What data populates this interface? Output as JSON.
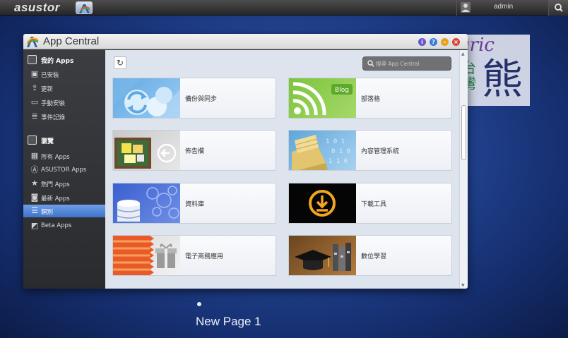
{
  "topbar": {
    "brand": "asustor",
    "username": "admin"
  },
  "watermark": {
    "gric": "gric",
    "taiwan": "台灣",
    "bear": "熊"
  },
  "window": {
    "title": "App Central",
    "buttons": [
      {
        "name": "info-icon",
        "glyph": "i",
        "color": "#6a55c7"
      },
      {
        "name": "help-icon",
        "glyph": "?",
        "color": "#3b7bd6"
      },
      {
        "name": "minimize-icon",
        "glyph": "–",
        "color": "#e3a21f"
      },
      {
        "name": "close-icon",
        "glyph": "×",
        "color": "#d9443a"
      }
    ]
  },
  "sidebar": {
    "my_apps": {
      "label": "我的 Apps",
      "items": [
        {
          "label": "已安裝",
          "icon": "installed-icon"
        },
        {
          "label": "更新",
          "icon": "update-icon"
        },
        {
          "label": "手動安裝",
          "icon": "folder-icon"
        },
        {
          "label": "事件記錄",
          "icon": "log-icon"
        }
      ]
    },
    "browse": {
      "label": "瀏覽",
      "items": [
        {
          "label": "所有 Apps",
          "icon": "grid-icon"
        },
        {
          "label": "ASUSTOR Apps",
          "icon": "asustor-icon"
        },
        {
          "label": "熱門 Apps",
          "icon": "star-icon"
        },
        {
          "label": "最新 Apps",
          "icon": "new-icon"
        },
        {
          "label": "類別",
          "icon": "list-icon",
          "active": true
        },
        {
          "label": "Beta Apps",
          "icon": "beta-icon"
        }
      ]
    }
  },
  "toolbar": {
    "search_placeholder": "搜尋 App Central"
  },
  "categories": [
    {
      "label": "備份與同步",
      "icon": "backup-sync-icon"
    },
    {
      "label": "部落格",
      "icon": "blog-icon",
      "badge": "Blog"
    },
    {
      "label": "佈告欄",
      "icon": "bulletin-board-icon"
    },
    {
      "label": "內容管理系統",
      "icon": "cms-icon"
    },
    {
      "label": "資料庫",
      "icon": "database-icon"
    },
    {
      "label": "下載工具",
      "icon": "download-icon"
    },
    {
      "label": "電子商務應用",
      "icon": "ecommerce-icon"
    },
    {
      "label": "數位學習",
      "icon": "elearning-icon"
    }
  ],
  "pager": {
    "label": "New Page 1"
  }
}
